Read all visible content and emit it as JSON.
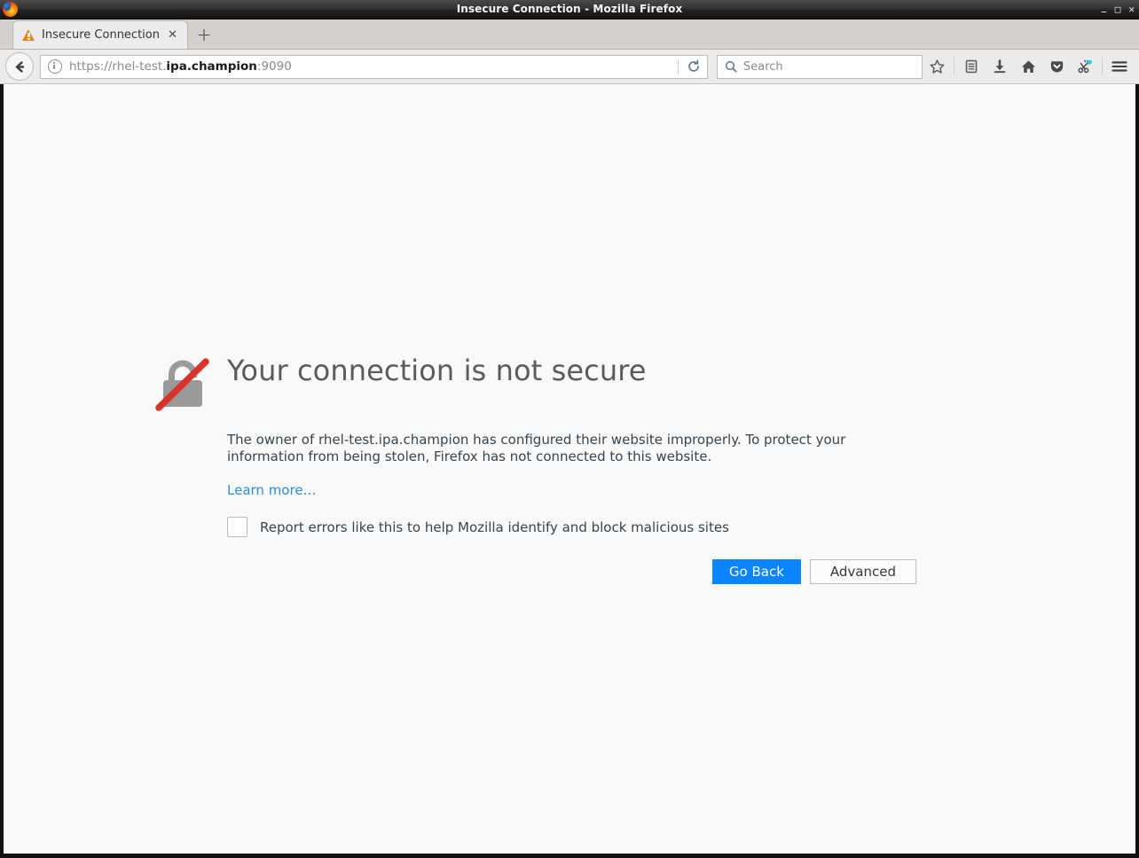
{
  "window": {
    "title": "Insecure Connection - Mozilla Firefox",
    "logo_icon": "firefox-logo",
    "controls": {
      "minimize": "−",
      "maximize": "□",
      "close": "✕"
    }
  },
  "tabs": [
    {
      "title": "Insecure Connection",
      "icon": "warning-triangle-icon",
      "close_label": "✕",
      "active": true
    }
  ],
  "new_tab_label": "+",
  "toolbar": {
    "back_icon": "back-arrow-icon",
    "url": {
      "identity_icon": "info-icon",
      "scheme_and_subdomain": "https://rhel-test.",
      "domain": "ipa.champion",
      "port": ":9090",
      "full": "https://rhel-test.ipa.champion:9090"
    },
    "reload_icon": "reload-icon",
    "search": {
      "icon": "search-icon",
      "placeholder": "Search",
      "value": ""
    },
    "icons": [
      {
        "name": "bookmark-star-icon",
        "label": "Bookmark this page"
      },
      {
        "name": "library-icon",
        "label": "Library"
      },
      {
        "name": "downloads-icon",
        "label": "Downloads"
      },
      {
        "name": "home-icon",
        "label": "Home"
      },
      {
        "name": "pocket-icon",
        "label": "Save to Pocket"
      },
      {
        "name": "clippings-icon",
        "label": "Clippings"
      },
      {
        "name": "menu-hamburger-icon",
        "label": "Open menu"
      }
    ]
  },
  "error_page": {
    "icon": "broken-padlock-icon",
    "heading": "Your connection is not secure",
    "paragraph": "The owner of rhel-test.ipa.champion has configured their website improperly. To protect your information from being stolen, Firefox has not connected to this website.",
    "learn_more": "Learn more…",
    "report_checkbox": {
      "label": "Report errors like this to help Mozilla identify and block malicious sites",
      "checked": false
    },
    "buttons": {
      "primary": "Go Back",
      "secondary": "Advanced"
    }
  },
  "colors": {
    "primary_button": "#0a84ff",
    "link": "#2a8bdb",
    "warning": "#e8821a",
    "slash_red": "#d9342b",
    "heading_text": "#5b5b5b",
    "body_text": "#38444d",
    "content_bg": "#f9f9f9"
  }
}
